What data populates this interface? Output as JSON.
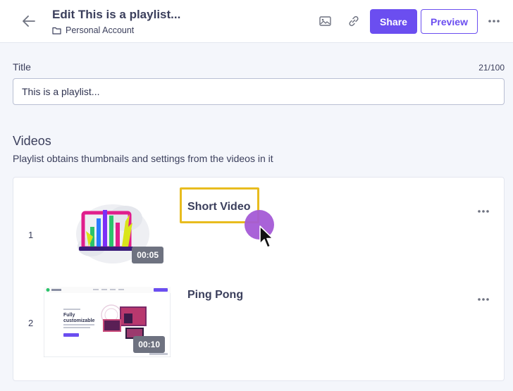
{
  "header": {
    "title": "Edit This is a playlist...",
    "breadcrumb": "Personal Account",
    "share_label": "Share",
    "preview_label": "Preview"
  },
  "form": {
    "title_label": "Title",
    "title_value": "This is a playlist...",
    "char_count": "21/100"
  },
  "videos": {
    "heading": "Videos",
    "subtitle": "Playlist obtains thumbnails and settings from the videos in it",
    "items": [
      {
        "index": "1",
        "title": "Short Video",
        "duration": "00:05"
      },
      {
        "index": "2",
        "title": "Ping Pong",
        "duration": "00:10"
      }
    ]
  },
  "thumbnail_text": {
    "fully": "Fully",
    "customizable": "customizable"
  },
  "colors": {
    "accent": "#6b4ef0",
    "highlight": "#e8bc1e",
    "click_indicator": "#a45ad6"
  }
}
